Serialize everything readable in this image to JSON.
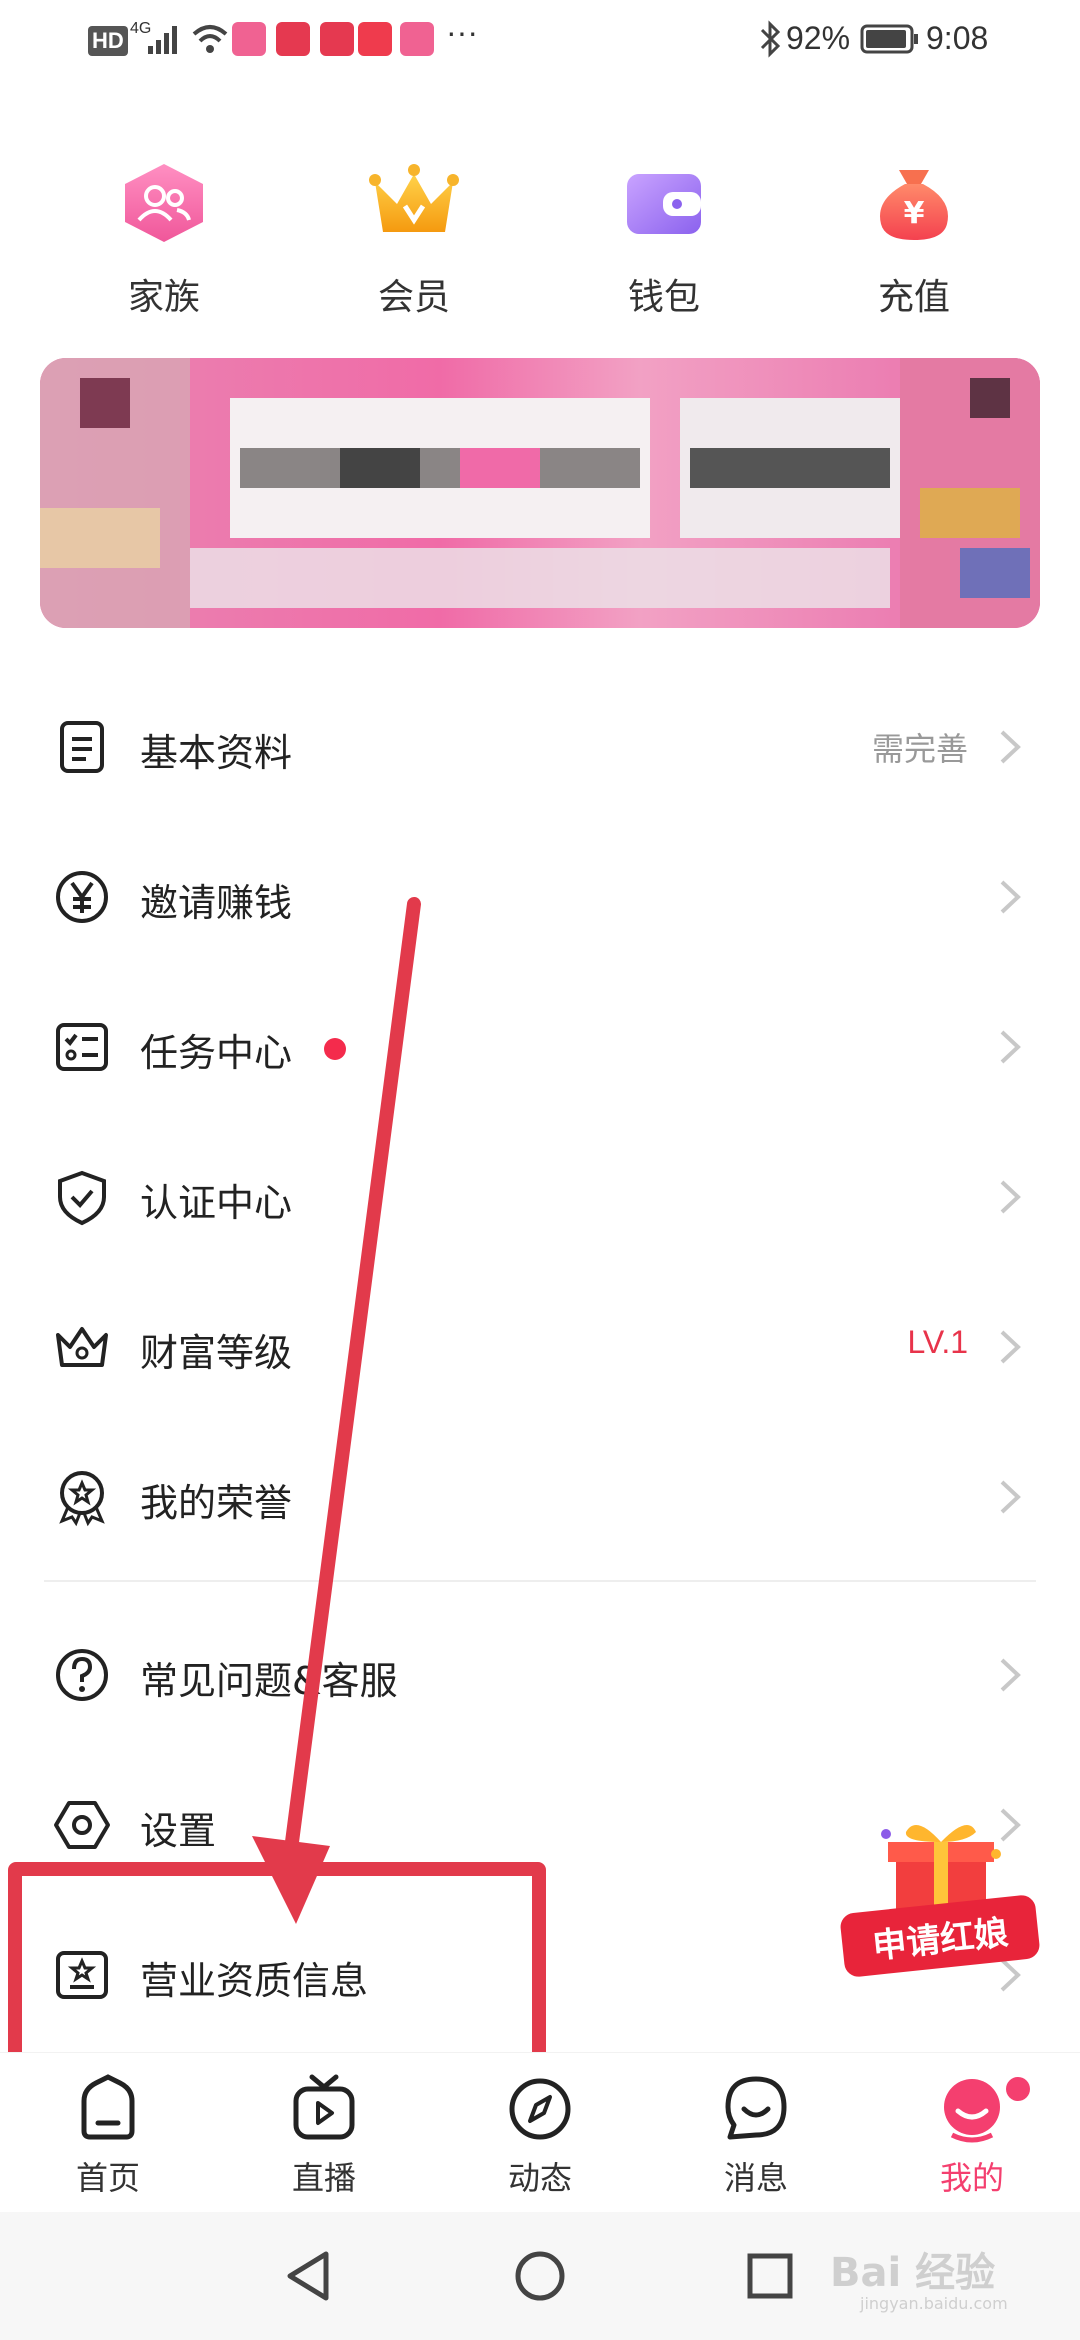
{
  "status_bar": {
    "left_icons": [
      "hd-icon",
      "4g-signal-icon",
      "wifi-icon",
      "app-notification-icon",
      "app-notification-icon",
      "app-notification-icon",
      "huawei-icon",
      "app-notification-icon",
      "more-icon"
    ],
    "hd": "HD",
    "network": "4G",
    "more": "···",
    "battery": "92%",
    "time": "9:08"
  },
  "quick_actions": [
    {
      "label": "家族",
      "icon": "family-icon",
      "color": "#f06aa6"
    },
    {
      "label": "会员",
      "icon": "crown-icon",
      "color": "#f7a21b"
    },
    {
      "label": "钱包",
      "icon": "wallet-icon",
      "color": "#9f7bf0"
    },
    {
      "label": "充值",
      "icon": "money-bag-icon",
      "color": "#f5574f"
    }
  ],
  "menu": {
    "items": [
      {
        "label": "基本资料",
        "value": "需完善",
        "icon": "profile-document-icon"
      },
      {
        "label": "邀请赚钱",
        "value": "",
        "icon": "yen-coin-icon"
      },
      {
        "label": "任务中心",
        "value": "",
        "icon": "task-checklist-icon",
        "badge": "red-dot"
      },
      {
        "label": "认证中心",
        "value": "",
        "icon": "shield-check-icon"
      },
      {
        "label": "财富等级",
        "value": "LV.1",
        "icon": "crown-outline-icon",
        "value_color": "#e8334a"
      },
      {
        "label": "我的荣誉",
        "value": "",
        "icon": "medal-icon"
      },
      {
        "label": "常见问题&客服",
        "value": "",
        "icon": "help-question-icon"
      },
      {
        "label": "设置",
        "value": "",
        "icon": "settings-hexagon-icon"
      },
      {
        "label": "营业资质信息",
        "value": "",
        "icon": "business-license-icon"
      }
    ]
  },
  "floating_promo": {
    "label": "申请红娘",
    "icon": "gift-box-icon"
  },
  "tab_bar": {
    "tabs": [
      {
        "label": "首页",
        "icon": "home-icon",
        "active": false
      },
      {
        "label": "直播",
        "icon": "live-tv-icon",
        "active": false
      },
      {
        "label": "动态",
        "icon": "compass-icon",
        "active": false
      },
      {
        "label": "消息",
        "icon": "chat-bubble-icon",
        "active": false
      },
      {
        "label": "我的",
        "icon": "avatar-face-icon",
        "active": true
      }
    ],
    "active_color": "#f43f6f"
  },
  "nav_bar": {
    "icons": [
      "back-triangle-icon",
      "home-circle-icon",
      "recents-square-icon"
    ]
  },
  "watermark": {
    "text": "Bai 经验",
    "subtext": "jingyan.baidu.com"
  },
  "colors": {
    "accent": "#f43f6f",
    "annotation": "#e23a4b"
  }
}
